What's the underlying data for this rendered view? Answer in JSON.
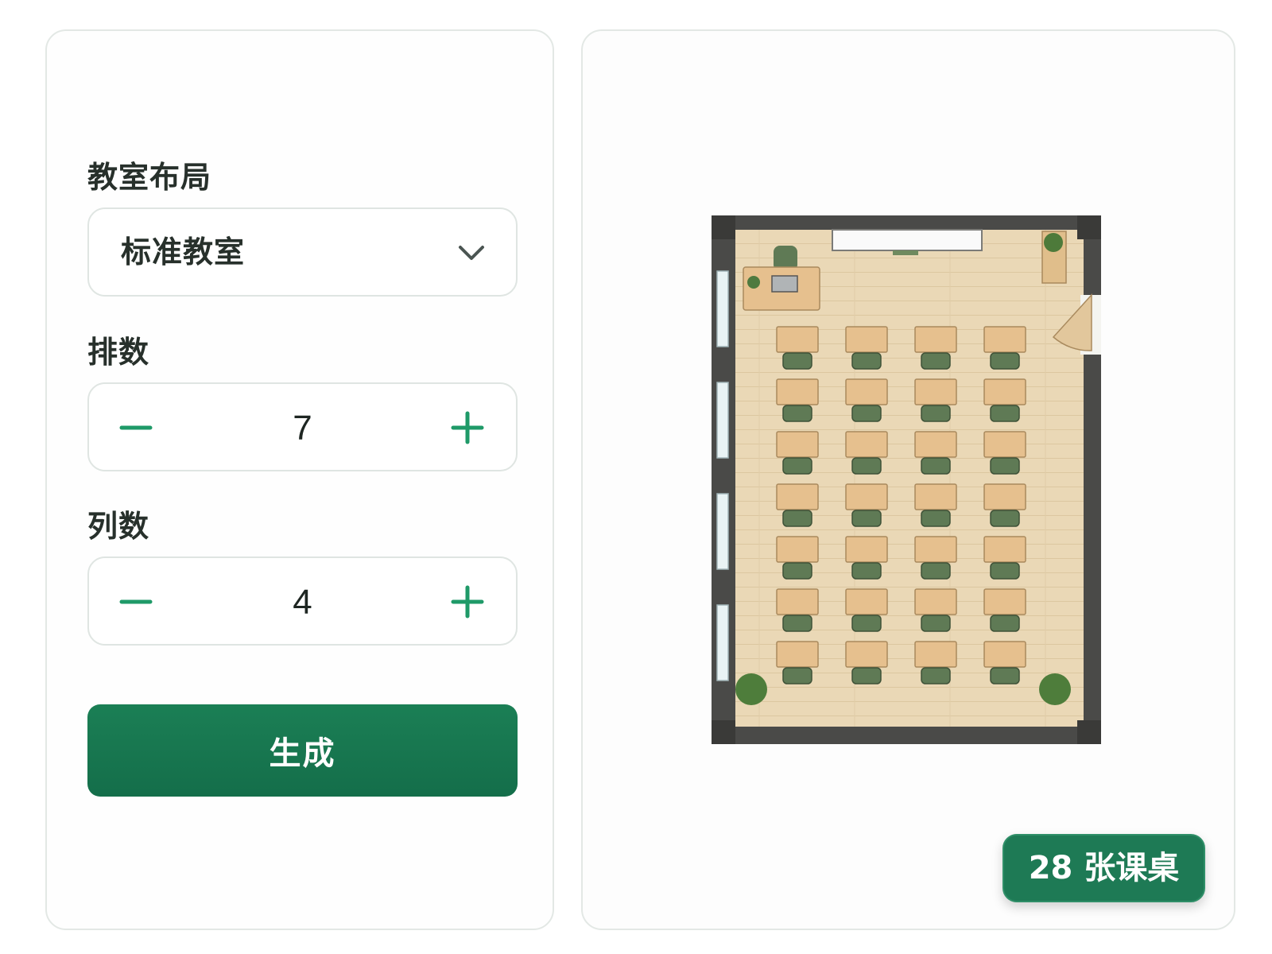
{
  "form": {
    "layout_label": "教室布局",
    "layout_value": "标准教室",
    "rows_label": "排数",
    "rows_value": "7",
    "cols_label": "列数",
    "cols_value": "4",
    "generate_label": "生成"
  },
  "preview": {
    "badge": "28 张课桌",
    "rows": 7,
    "cols": 4
  },
  "colors": {
    "accent": "#1b7f55",
    "plus_minus": "#1f9a68",
    "floor": "#ead8b6",
    "wall": "#4a4a48",
    "desk": "#e6c08e",
    "chair": "#5f7a55"
  },
  "icons": {
    "select": "chevron-down-icon",
    "decrement": "minus-icon",
    "increment": "plus-icon"
  }
}
